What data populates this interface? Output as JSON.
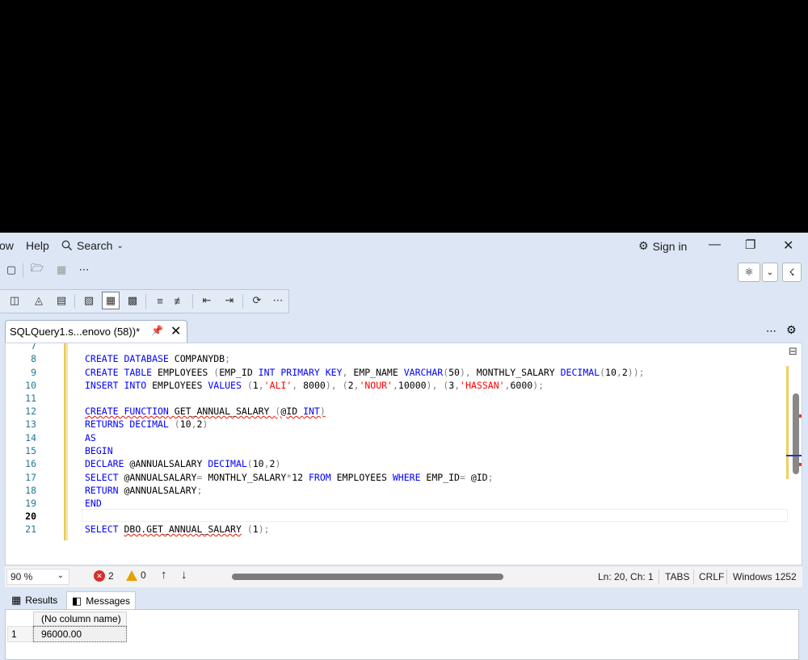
{
  "menu": {
    "partial_item": "ow",
    "help": "Help",
    "search": "Search",
    "sign_in": "Sign in"
  },
  "tab": {
    "title": "SQLQuery1.s...enovo (58))*"
  },
  "editor": {
    "line_numbers": [
      "7",
      "8",
      "9",
      "10",
      "11",
      "12",
      "13",
      "14",
      "15",
      "16",
      "17",
      "18",
      "19",
      "20",
      "21"
    ],
    "current_line": "20"
  },
  "status": {
    "zoom": "90 %",
    "errors": "2",
    "warnings": "0",
    "position": "Ln: 20, Ch: 1",
    "indent": "TABS",
    "line_ending": "CRLF",
    "encoding": "Windows 1252"
  },
  "results": {
    "tab_results": "Results",
    "tab_messages": "Messages",
    "column_header": "(No column name)",
    "row_number": "1",
    "row_value": "96000.00"
  },
  "colors": {
    "keyword": "#0000ff",
    "string": "#ff0000",
    "line_number": "#237893",
    "chrome_bg": "#dce6f4"
  },
  "icons": [
    "search-icon",
    "sign-in-icon",
    "minimize-icon",
    "restore-icon",
    "close-icon",
    "pin-icon",
    "settings-icon",
    "error-icon",
    "warning-icon",
    "up-arrow-icon",
    "down-arrow-icon",
    "grid-icon",
    "messages-icon"
  ]
}
